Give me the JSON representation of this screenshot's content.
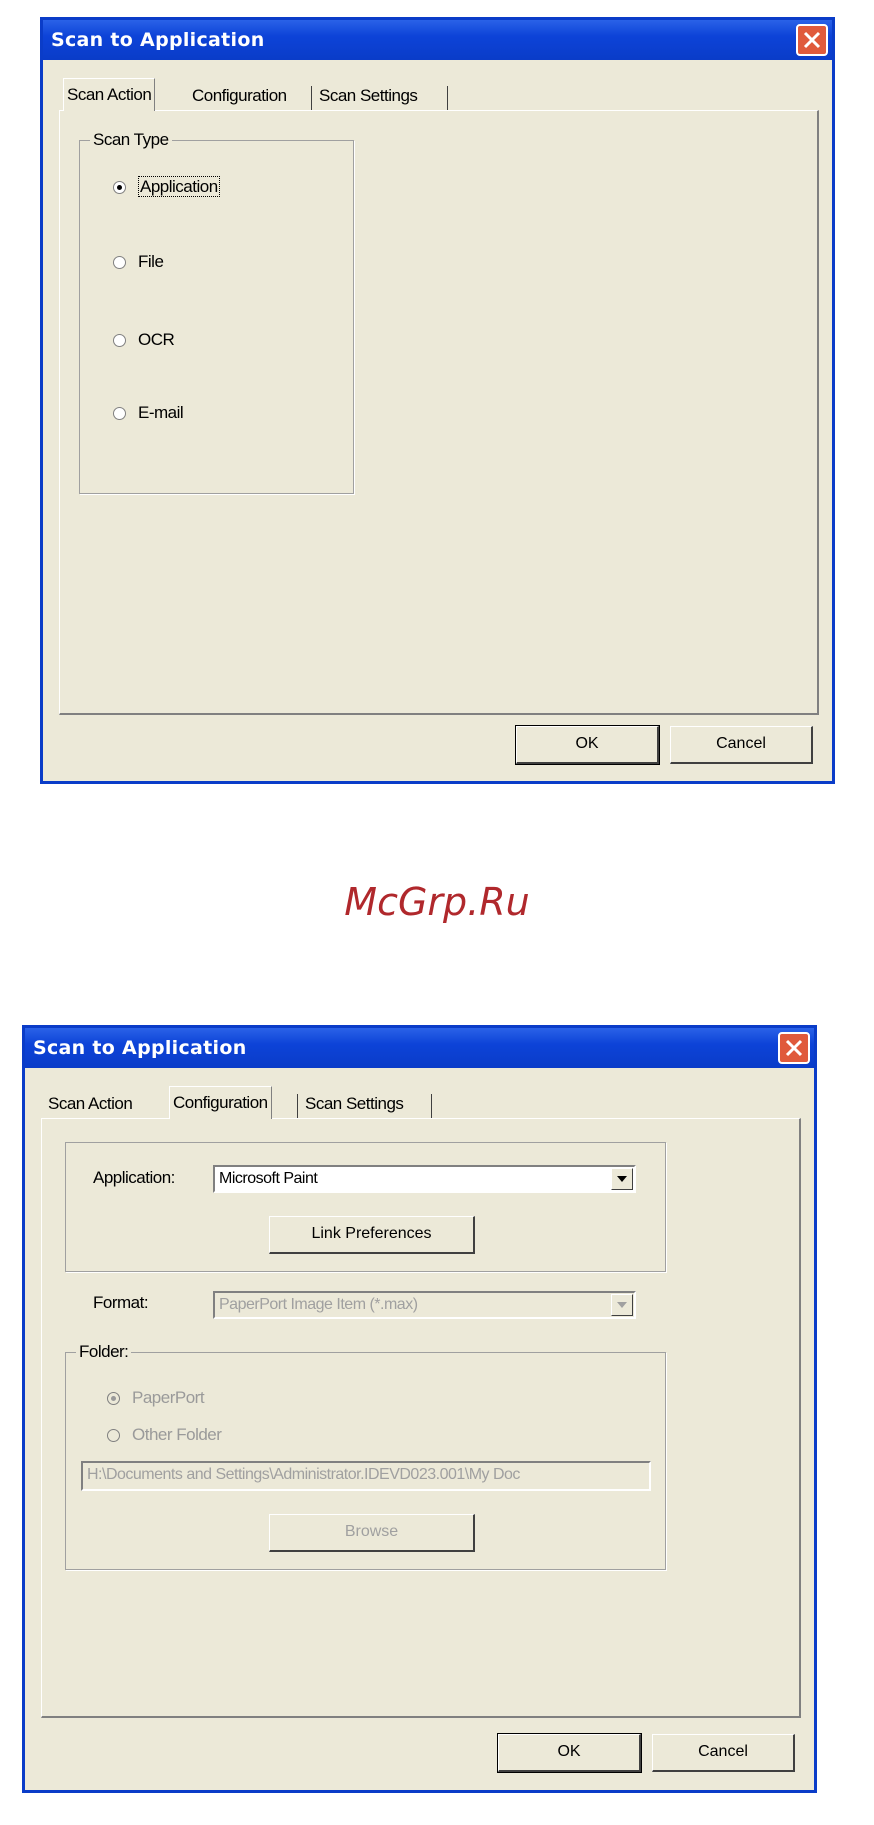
{
  "dialog1": {
    "title": "Scan to Application",
    "tabs": [
      "Scan Action",
      "Configuration",
      "Scan Settings"
    ],
    "active_tab": "Scan Action",
    "scan_type_label": "Scan Type",
    "scan_types": [
      {
        "label": "Application",
        "checked": true
      },
      {
        "label": "File",
        "checked": false
      },
      {
        "label": "OCR",
        "checked": false
      },
      {
        "label": "E-mail",
        "checked": false
      }
    ],
    "ok_label": "OK",
    "cancel_label": "Cancel"
  },
  "watermark": "McGrp.Ru",
  "dialog2": {
    "title": "Scan to Application",
    "tabs": [
      "Scan Action",
      "Configuration",
      "Scan Settings"
    ],
    "active_tab": "Configuration",
    "application_label": "Application:",
    "application_value": "Microsoft Paint",
    "link_preferences_label": "Link Preferences",
    "format_label": "Format:",
    "format_value": "PaperPort Image Item (*.max)",
    "folder_label": "Folder:",
    "folder_options": [
      {
        "label": "PaperPort",
        "checked": true
      },
      {
        "label": "Other Folder",
        "checked": false
      }
    ],
    "path_value": "H:\\Documents and Settings\\Administrator.IDEVD023.001\\My Doc",
    "browse_label": "Browse",
    "ok_label": "OK",
    "cancel_label": "Cancel"
  },
  "colors": {
    "title_bar": "#0a3cc8",
    "dialog_bg": "#ece9d8",
    "close_button": "#e05a3c",
    "watermark": "#b0282c"
  }
}
